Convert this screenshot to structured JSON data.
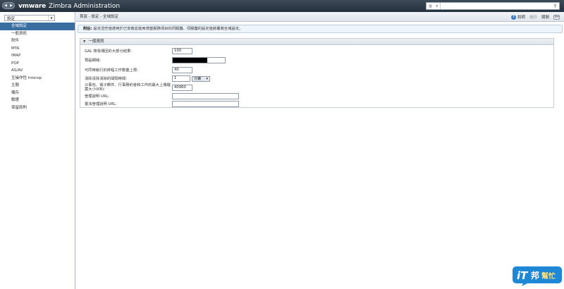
{
  "app": {
    "brand_logo": "vmware",
    "brand_product": "Zimbra Administration"
  },
  "search": {
    "placeholder": "",
    "value": "",
    "type_icon": "building-icon",
    "button_icon": "search-icon"
  },
  "sidebar": {
    "select_value": "設定",
    "items": [
      {
        "label": "全域設定",
        "active": true
      },
      {
        "label": "一般資訊",
        "active": false
      },
      {
        "label": "附件",
        "active": false
      },
      {
        "label": "MTA",
        "active": false
      },
      {
        "label": "IMAP",
        "active": false
      },
      {
        "label": "POP",
        "active": false
      },
      {
        "label": "AS/AV",
        "active": false
      },
      {
        "label": "互操作性 Interop",
        "active": false
      },
      {
        "label": "主題",
        "active": false
      },
      {
        "label": "備存",
        "active": false
      },
      {
        "label": "驗證",
        "active": false
      },
      {
        "label": "保留原則",
        "active": false
      }
    ]
  },
  "toolbar": {
    "breadcrumb": "首頁 - 設定 - 全域設定",
    "help_label": "說明",
    "save_label": "儲存",
    "close_label": "關閉"
  },
  "note": {
    "prefix": "附註:",
    "text": "設定這些值適用於已安裝並啟用適當服務項目的伺服器。伺服器的設定值將覆寫全域設定。"
  },
  "section": {
    "title": "一般資訊",
    "rows": {
      "gal_max_label": "GAL 搜尋傳回的大部分結果:",
      "gal_max_value": "100",
      "default_domain_label": "預設網域:",
      "default_domain_value": "",
      "max_threads_label": "可同時執行的排程工作數量上限:",
      "max_threads_value": "40",
      "sleep_interval_label": "清除清除清除的間隔時間:",
      "sleep_interval_value": "1",
      "sleep_interval_unit": "分鐘",
      "upload_max_label": "公事包、電子郵件、行事曆約會和工作的最大上傳檔案大小(KB):",
      "upload_max_value": "40960",
      "admin_help_url_label": "管理說明 URL:",
      "admin_help_url_value": "",
      "delegated_help_url_label": "委派管理說明 URL:",
      "delegated_help_url_value": ""
    }
  },
  "colors": {
    "topbar": "#2b3743",
    "active_item": "#3b6ea0",
    "note_bg": "#eef4fb"
  },
  "watermark": {
    "text": "iT邦幫忙"
  }
}
